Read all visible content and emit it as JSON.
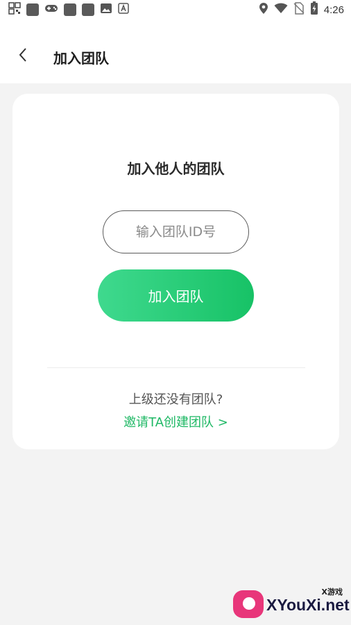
{
  "status_bar": {
    "time": "4:26",
    "left_icons": [
      "qr-icon",
      "app-icon",
      "gamepad-icon",
      "app-icon",
      "app-icon",
      "image-icon",
      "font-icon"
    ],
    "right_icons": [
      "location-icon",
      "wifi-icon",
      "no-sim-icon",
      "battery-charging-icon"
    ]
  },
  "header": {
    "title": "加入团队",
    "back_icon": "chevron-left-icon"
  },
  "card": {
    "title": "加入他人的团队",
    "input_placeholder": "输入团队ID号",
    "input_value": "",
    "join_button_label": "加入团队",
    "no_team_text": "上级还没有团队?",
    "invite_link_text": "邀请TA创建团队 >"
  },
  "watermark": {
    "sub": "X游戏",
    "main": "XYouXi.net"
  },
  "colors": {
    "accent_green": "#17c266",
    "accent_green_light": "#3fd98e",
    "link_green": "#1fb865",
    "background": "#f3f3f3"
  }
}
